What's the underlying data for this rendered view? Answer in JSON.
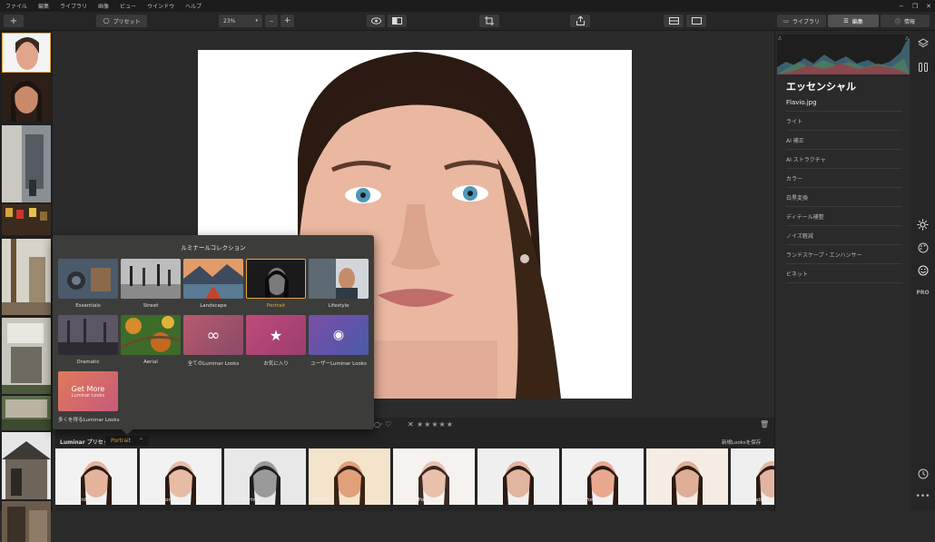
{
  "menu": [
    "ファイル",
    "編集",
    "ライブラリ",
    "画像",
    "ビュー",
    "ウインドウ",
    "ヘルプ"
  ],
  "toolbar": {
    "add_label": "+",
    "preset_label": "プリセット",
    "zoom_value": "23%",
    "zoom_out": "−",
    "zoom_in": "+"
  },
  "right_tabs": {
    "library": "ライブラリ",
    "edit": "編集",
    "info": "情報"
  },
  "panel": {
    "title": "エッセンシャル",
    "filename": "Flavio.jpg",
    "tools": [
      "ライト",
      "AI 補正",
      "AI ストラクチャ",
      "カラー",
      "白黒変換",
      "ディテール補整",
      "ノイズ軽減",
      "ランドスケープ・エンハンサー",
      "ビネット"
    ]
  },
  "popover": {
    "title": "ルミナールコレクション",
    "collections": [
      "Essentials",
      "Street",
      "Landscape",
      "Portrait",
      "Lifestyle",
      "Dramatic",
      "Aerial",
      "全てのLuminar Looks",
      "お気に入り",
      "ユーザーLuminar Looks"
    ],
    "get_more": {
      "big": "Get More",
      "small": "Luminar Looks",
      "label": "多くを得るLuminar Looks"
    }
  },
  "bottom": {
    "collection_label": "Luminar プリセット",
    "collection_value": "Portrait",
    "save_label": "新規Looksを保存",
    "rating": "★★★★★"
  },
  "presets": [
    "AI Face Enhancer",
    "Artistic Portrait",
    "Black Portrait",
    "Desert",
    "Dreamy Portrait",
    "Escape",
    "Female Portrait",
    "Film",
    "Street Matte"
  ],
  "colors": {
    "accent": "#e7a63a",
    "panel": "#2a2a2a"
  }
}
